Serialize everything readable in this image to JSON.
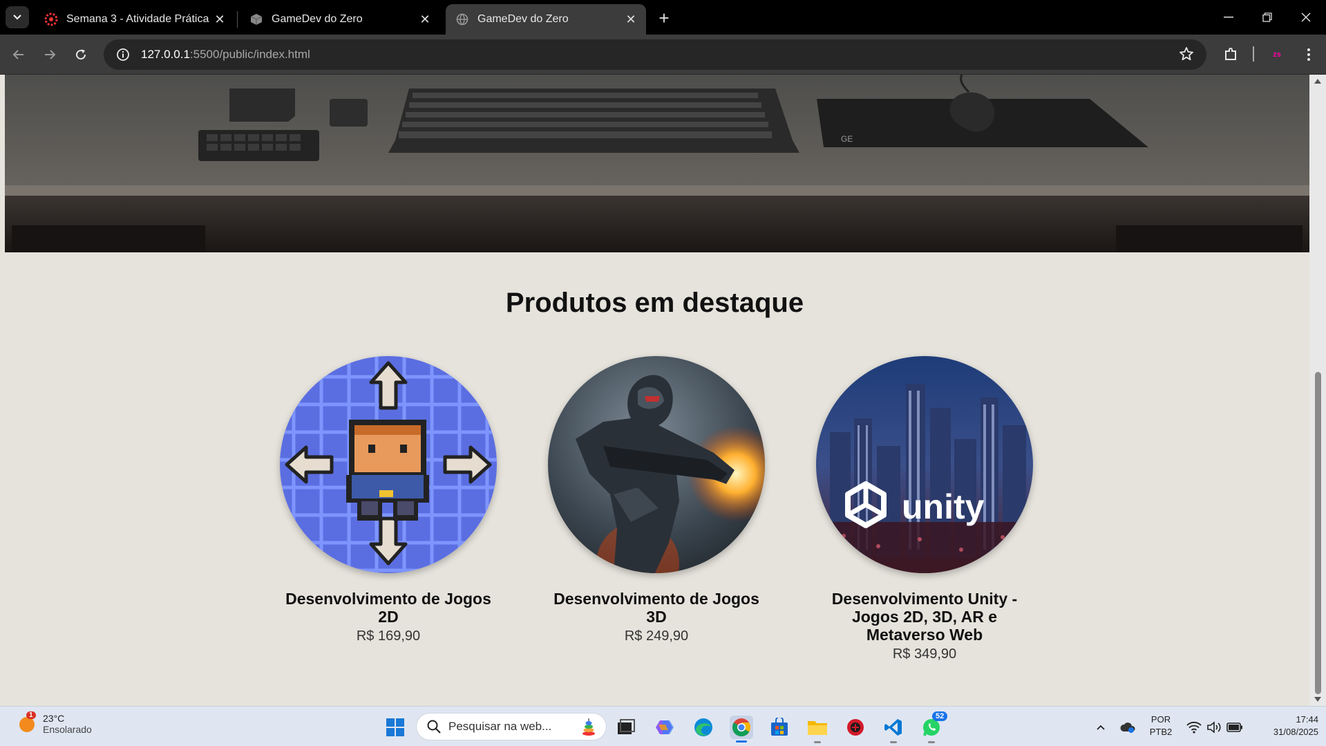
{
  "browser": {
    "tabs": [
      {
        "title": "Semana 3 - Atividade Prática",
        "favicon": "gear-red-icon",
        "active": false
      },
      {
        "title": "GameDev do Zero",
        "favicon": "cube-icon",
        "active": false
      },
      {
        "title": "GameDev do Zero",
        "favicon": "globe-icon",
        "active": true
      }
    ],
    "url_host": "127.0.0.1",
    "url_path": ":5500/public/index.html",
    "profile_initials": "zs"
  },
  "page": {
    "section_title": "Produtos em destaque",
    "products": [
      {
        "name": "Desenvolvimento de Jogos 2D",
        "price": "R$ 169,90",
        "image": "pixel-character-arrows"
      },
      {
        "name": "Desenvolvimento de Jogos 3D",
        "price": "R$ 249,90",
        "image": "armored-soldier-3d"
      },
      {
        "name": "Desenvolvimento Unity - Jogos 2D, 3D, AR e Metaverso Web",
        "price": "R$ 349,90",
        "image": "city-unity-logo"
      }
    ],
    "unity_logo_text": "unity"
  },
  "taskbar": {
    "weather_temp": "23°C",
    "weather_cond": "Ensolarado",
    "weather_badge": "1",
    "search_placeholder": "Pesquisar na web...",
    "whatsapp_badge": "52",
    "lang_line1": "POR",
    "lang_line2": "PTB2",
    "time": "17:44",
    "date": "31/08/2025"
  },
  "colors": {
    "page_bg": "#e6e3dc",
    "product_2d_bg": "#5b6ee1",
    "taskbar_bg": "#dfe6f2"
  }
}
